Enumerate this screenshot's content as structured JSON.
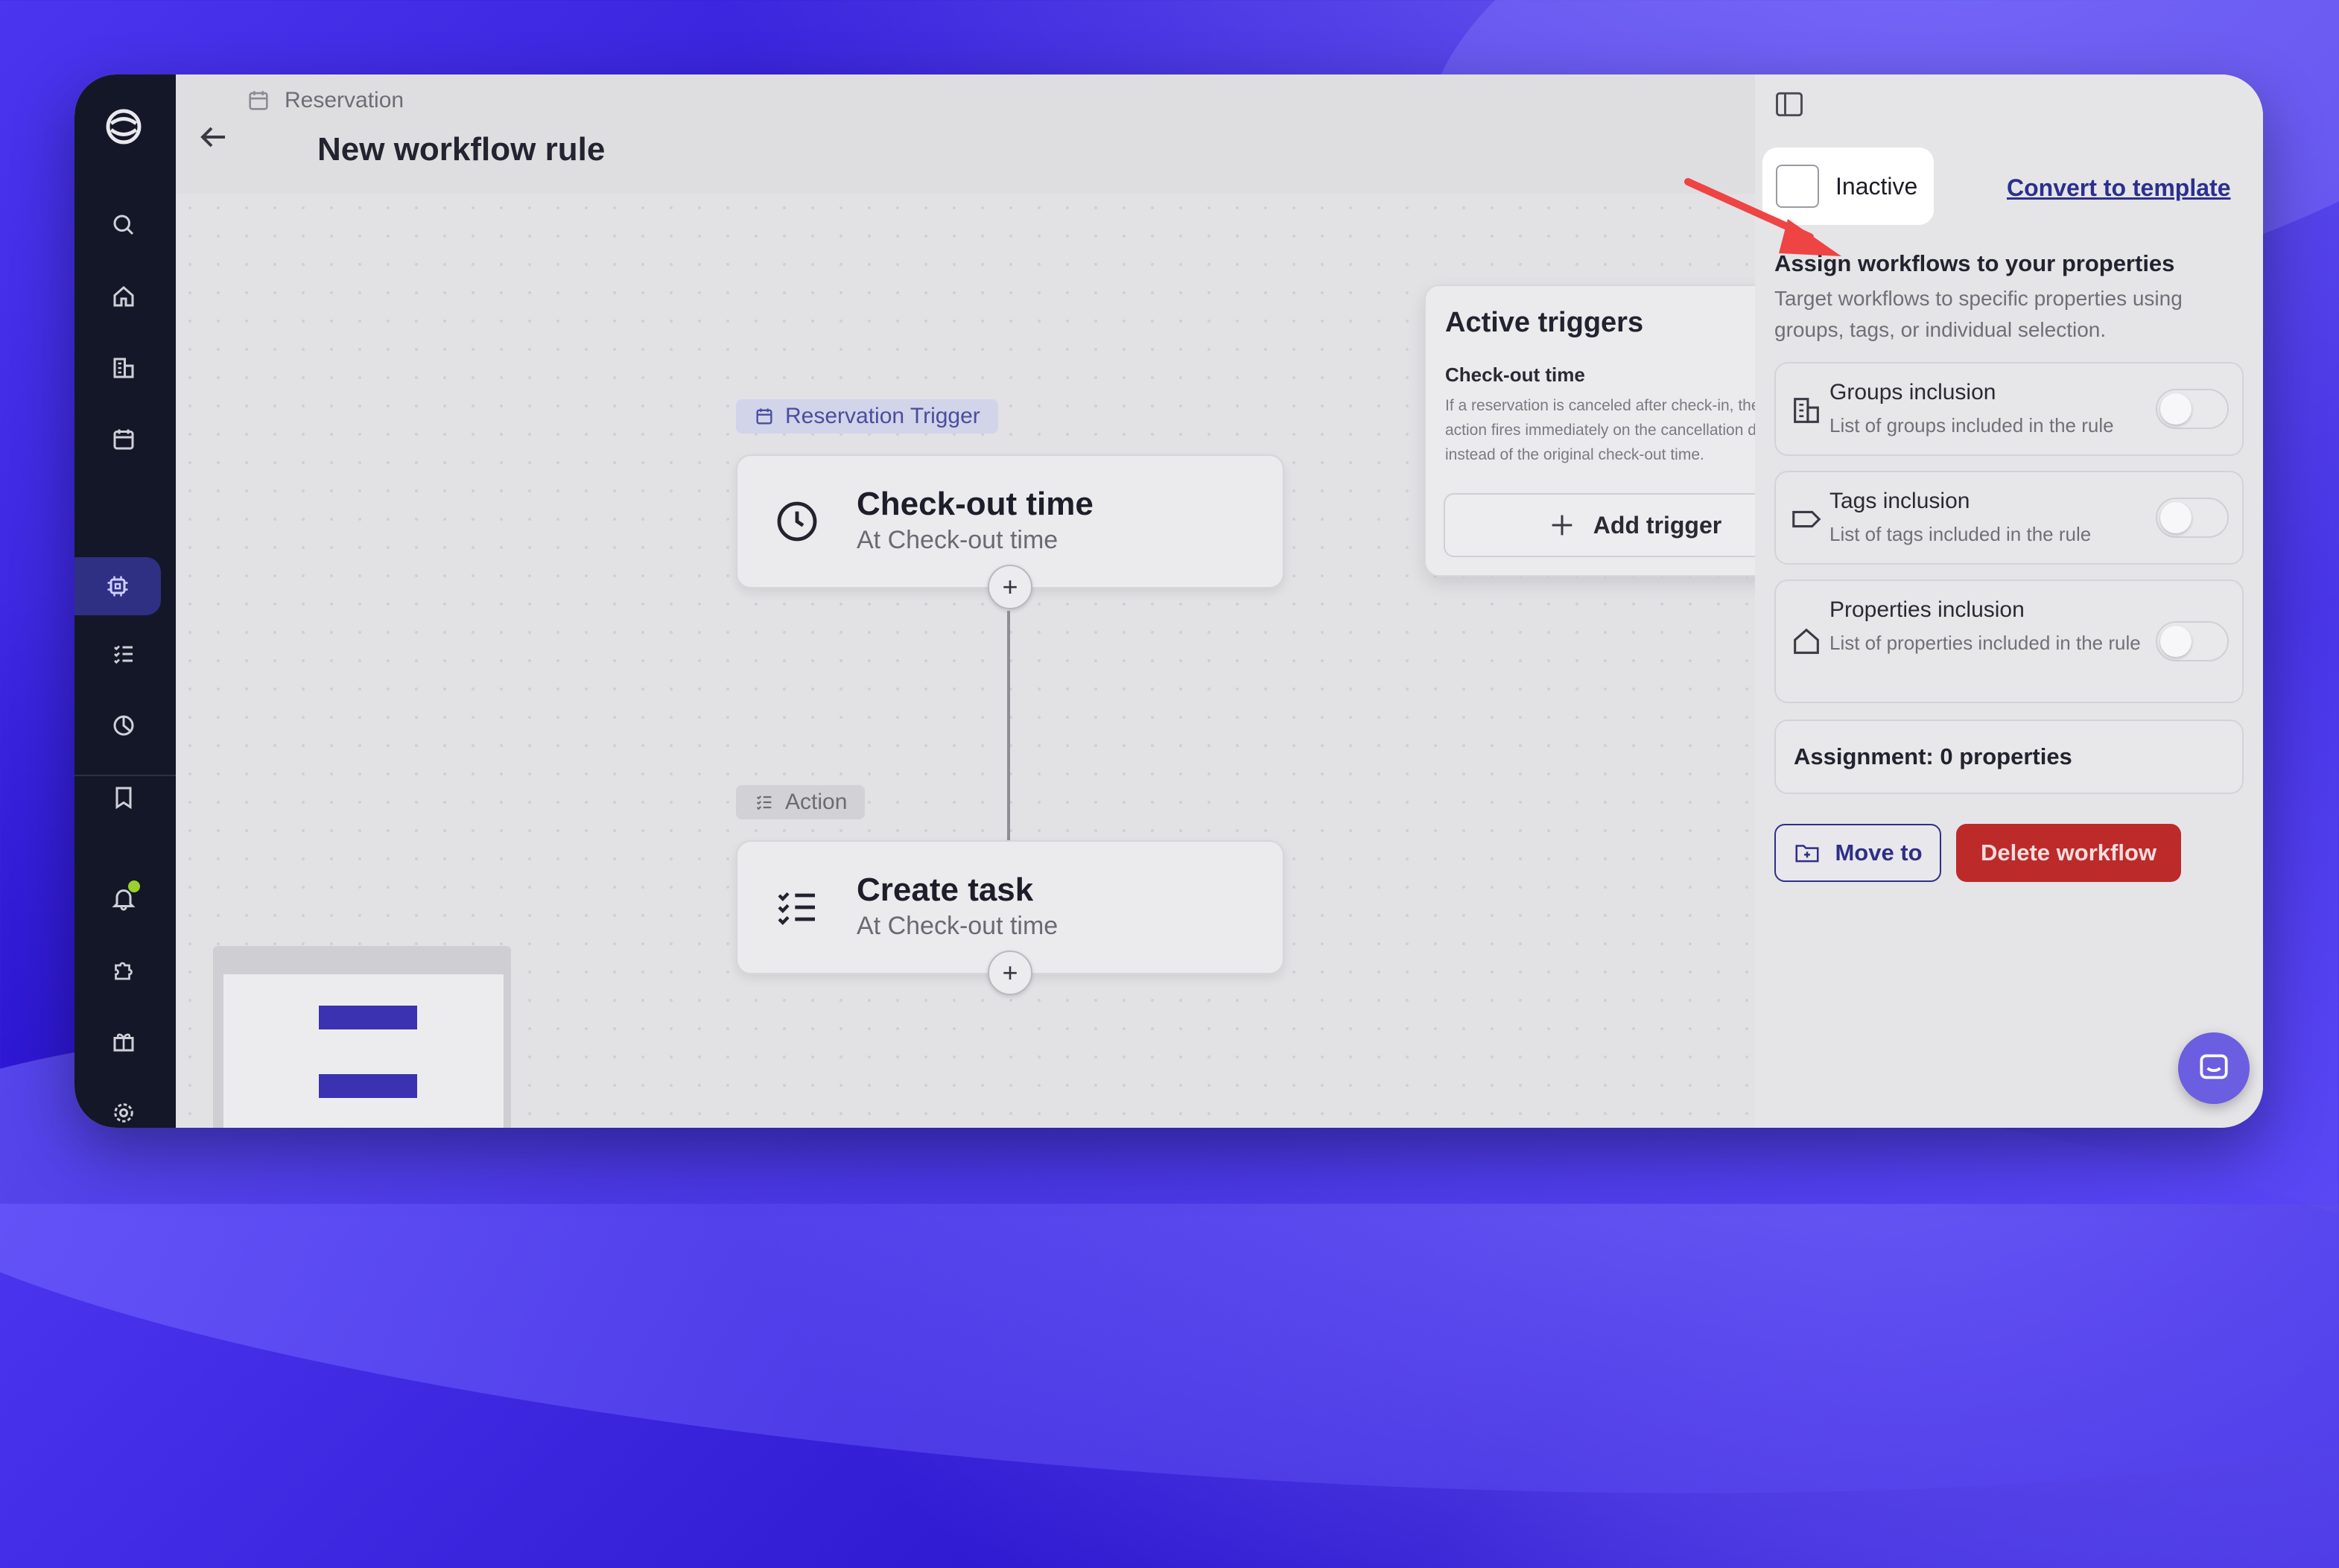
{
  "header": {
    "breadcrumb": "Reservation",
    "title": "New workflow rule"
  },
  "canvas": {
    "trigger_chip": "Reservation Trigger",
    "trigger_node": {
      "title": "Check-out time",
      "subtitle": "At Check-out time"
    },
    "action_chip": "Action",
    "action_node": {
      "title": "Create task",
      "subtitle": "At Check-out time"
    },
    "plus": "+"
  },
  "active_triggers": {
    "title": "Active triggers",
    "item_title": "Check-out time",
    "item_desc": "If a reservation is canceled after check-in, the action fires immediately on the cancellation date instead of the original check-out time.",
    "add_label": "Add trigger"
  },
  "panel": {
    "status_label": "Inactive",
    "convert_label": "Convert to template",
    "assign_title": "Assign workflows to your properties",
    "assign_desc": "Target workflows to specific properties using groups, tags, or individual selection.",
    "options": [
      {
        "title": "Groups inclusion",
        "desc": "List of groups included in the rule",
        "enabled": false
      },
      {
        "title": "Tags inclusion",
        "desc": "List of tags included in the rule",
        "enabled": false
      },
      {
        "title": "Properties inclusion",
        "desc": "List of properties included in the rule",
        "enabled": false
      }
    ],
    "assignment_count": "Assignment: 0 properties",
    "move_label": "Move to",
    "delete_label": "Delete workflow"
  },
  "colors": {
    "accent": "#2f2f86",
    "danger": "#bd2a2a",
    "sidebar_bg": "#141728",
    "annotation_arrow": "#ef4444"
  }
}
